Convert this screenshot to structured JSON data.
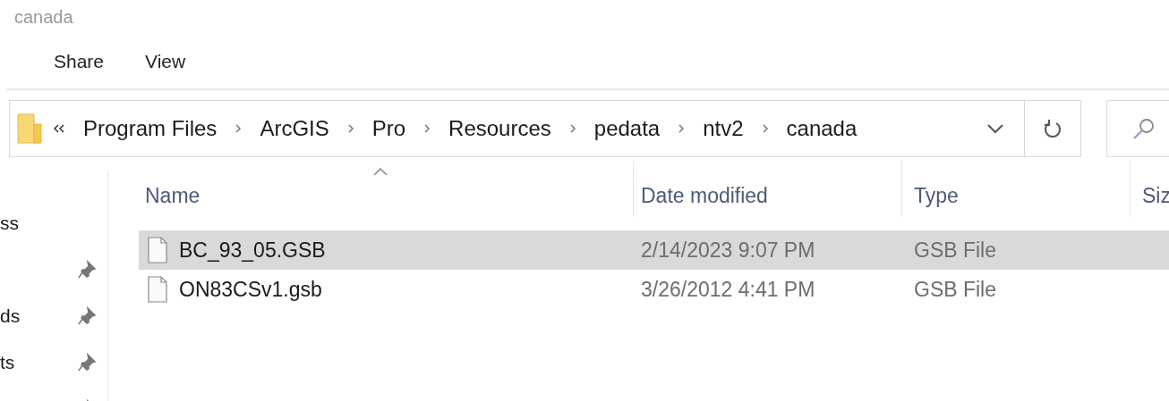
{
  "window": {
    "title": "canada"
  },
  "ribbon_tabs": [
    {
      "label": "Share",
      "selected": false
    },
    {
      "label": "View",
      "selected": false
    }
  ],
  "address_bar": {
    "crumbs": [
      "Program Files",
      "ArcGIS",
      "Pro",
      "Resources",
      "pedata",
      "ntv2",
      "canada"
    ]
  },
  "nav_pane": {
    "items": [
      {
        "label": "ss",
        "pinned": false
      },
      {
        "pinned": true
      },
      {
        "label": "ds",
        "pinned": true
      },
      {
        "label": "ts",
        "pinned": true
      },
      {
        "pinned": true
      }
    ]
  },
  "file_list": {
    "columns": [
      {
        "label": "Name",
        "sorted": true
      },
      {
        "label": "Date modified",
        "sorted": false
      },
      {
        "label": "Type",
        "sorted": false
      },
      {
        "label": "Siz",
        "sorted": false
      }
    ],
    "rows": [
      {
        "name": "BC_93_05.GSB",
        "date": "2/14/2023 9:07 PM",
        "type": "GSB File",
        "selected": true
      },
      {
        "name": "ON83CSv1.gsb",
        "date": "3/26/2012 4:41 PM",
        "type": "GSB File",
        "selected": false
      }
    ]
  }
}
